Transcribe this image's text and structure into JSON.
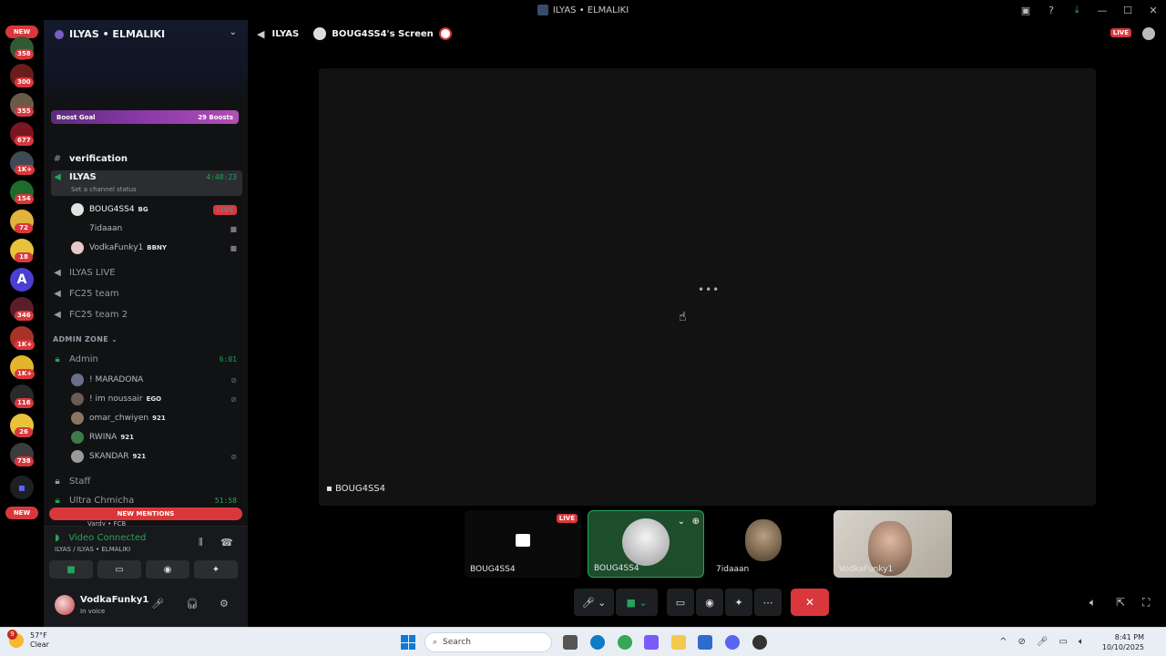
{
  "window": {
    "title": "ILYAS • ELMALIKI"
  },
  "rail": {
    "new_top": "NEW",
    "new_bottom": "NEW",
    "badges": [
      "358",
      "300",
      "355",
      "677",
      "1K+",
      "154",
      "72",
      "18",
      "346",
      "1K+",
      "1K+",
      "116",
      "26",
      "738"
    ]
  },
  "server": {
    "name": "ILYAS • ELMALIKI",
    "boost_goal": "Boost Goal",
    "boosts": "29 Boosts"
  },
  "channels": {
    "verification": "verification",
    "ilyas": {
      "name": "ILYAS",
      "time": "4:48:23",
      "status": "Set a channel status"
    },
    "ilyas_members": [
      {
        "name": "BOUG4SS4",
        "tag": "BG",
        "live": "LIVE"
      },
      {
        "name": "7idaaan"
      },
      {
        "name": "VodkaFunky1",
        "tag": "BBNY"
      }
    ],
    "ilyas_live": "ILYAS LIVE",
    "fc25_team": "FC25 team",
    "fc25_team2": "FC25 team 2",
    "admin_zone": "ADMIN ZONE",
    "admin": {
      "name": "Admin",
      "time": "6:01"
    },
    "admin_members": [
      {
        "name": "! MARADONA"
      },
      {
        "name": "! im noussair",
        "tag": "EGO"
      },
      {
        "name": "omar_chwiyen",
        "tag": "921"
      },
      {
        "name": "RWINA",
        "tag": "921"
      },
      {
        "name": "SKANDAR",
        "tag": "921"
      }
    ],
    "staff": "Staff",
    "ultra": {
      "name": "Ultra Chmicha",
      "time": "51:58"
    },
    "partial_member": "Vardy • FCB",
    "new_mentions": "NEW MENTIONS"
  },
  "voice": {
    "title": "Video Connected",
    "sub": "ILYAS / ILYAS • ELMALIKI"
  },
  "user": {
    "name": "VodkaFunky1",
    "status": "In voice"
  },
  "stream": {
    "channel": "ILYAS",
    "screen_title": "BOUG4SS4's Screen",
    "live": "LIVE",
    "screen_label": "BOUG4SS4",
    "loading": "•••"
  },
  "tiles": [
    {
      "label": "BOUG4SS4",
      "live": "LIVE"
    },
    {
      "label": "BOUG4SS4"
    },
    {
      "label": "7idaaan"
    },
    {
      "label": "VodkaFunky1"
    }
  ],
  "taskbar": {
    "weather_temp": "57°F",
    "weather_desc": "Clear",
    "notif": "9",
    "search": "Search",
    "time": "8:41 PM",
    "date": "10/10/2025"
  },
  "colors": {
    "accent_red": "#da373c",
    "accent_green": "#23a55a",
    "boost": "#8a3aa8"
  }
}
